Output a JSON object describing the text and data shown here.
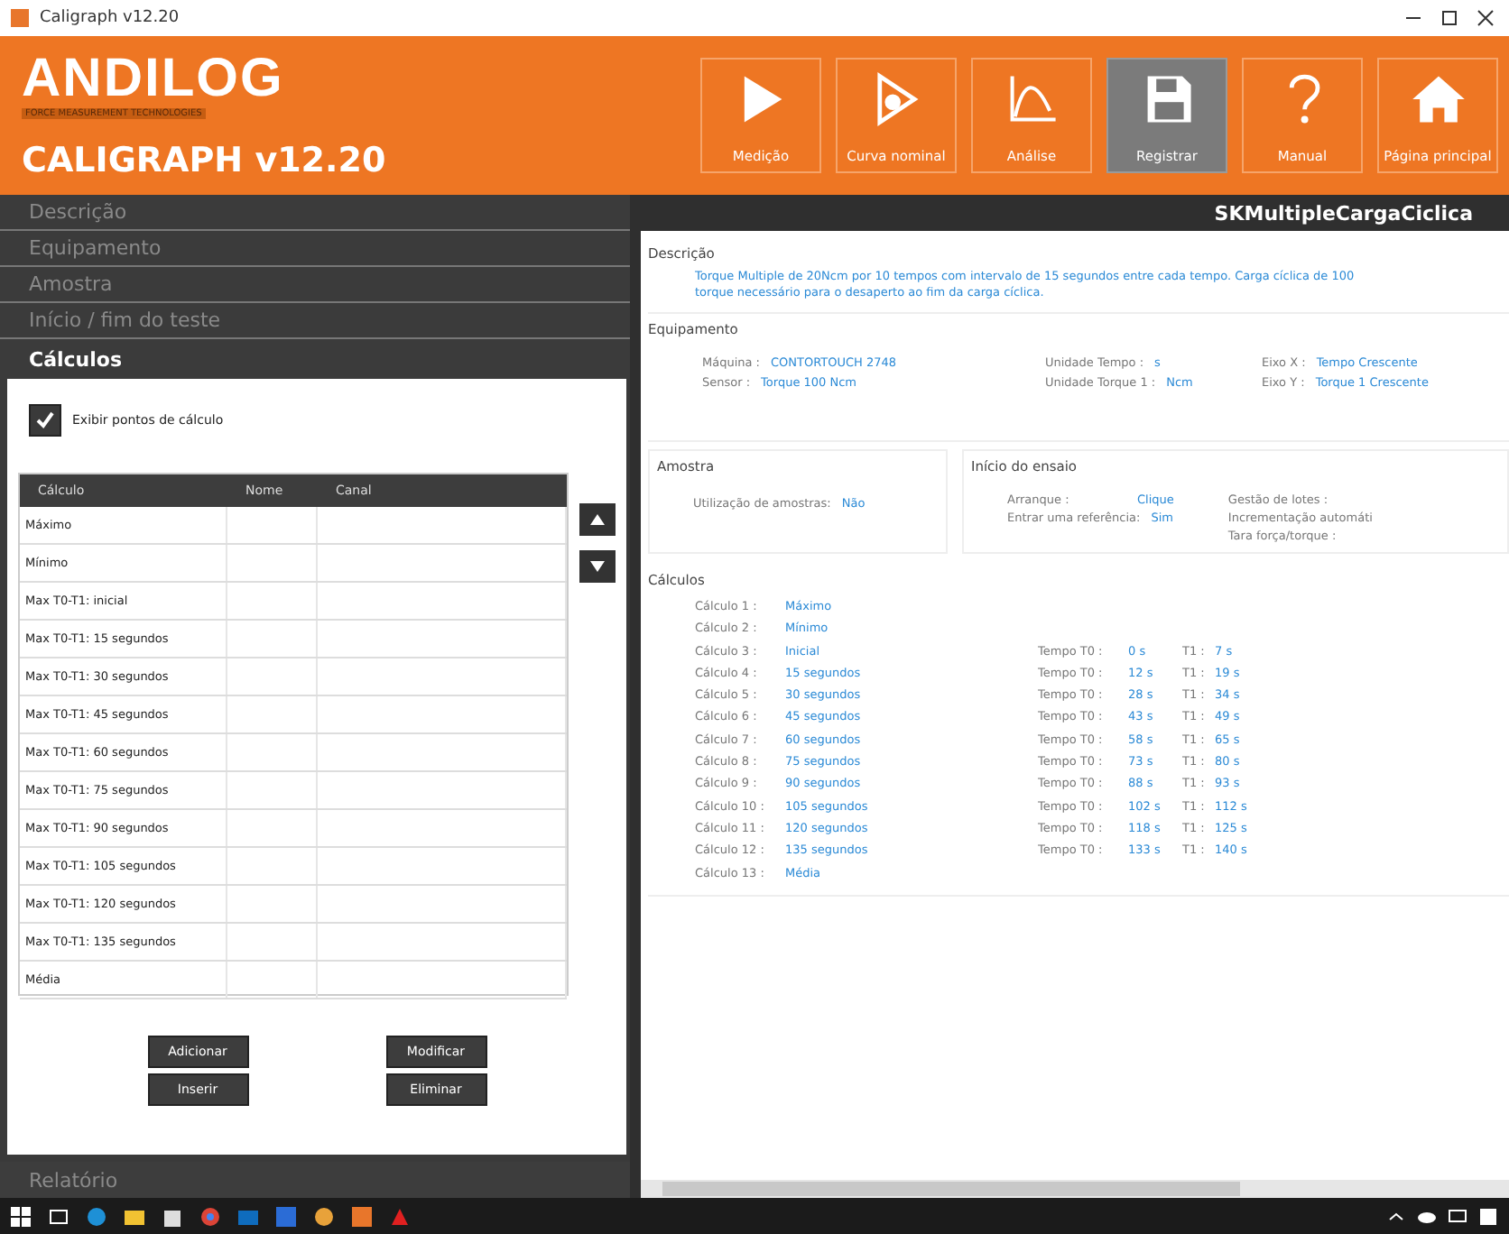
{
  "window": {
    "title": "Caligraph v12.20"
  },
  "brand": {
    "logo": "ANDILOG",
    "tagline": "FORCE MEASUREMENT TECHNOLOGIES",
    "product": "CALIGRAPH v12.20"
  },
  "toolbar": [
    {
      "label": "Medição",
      "kind": "play",
      "selected": false
    },
    {
      "label": "Curva nominal",
      "kind": "curve",
      "selected": false
    },
    {
      "label": "Análise",
      "kind": "chart",
      "selected": false
    },
    {
      "label": "Registrar",
      "kind": "save",
      "selected": true
    },
    {
      "label": "Manual",
      "kind": "help",
      "selected": false
    },
    {
      "label": "Página principal",
      "kind": "home",
      "selected": false
    }
  ],
  "sidebar": {
    "sections": [
      {
        "label": "Descrição",
        "expanded": false
      },
      {
        "label": "Equipamento",
        "expanded": false
      },
      {
        "label": "Amostra",
        "expanded": false
      },
      {
        "label": "Início / fim do teste",
        "expanded": false
      },
      {
        "label": "Cálculos",
        "expanded": true
      }
    ],
    "show_points": {
      "label": "Exibir pontos de cálculo",
      "checked": true
    },
    "table": {
      "columns": [
        "Cálculo",
        "Nome",
        "Canal"
      ],
      "rows": [
        "Máximo",
        "Mínimo",
        "Max T0-T1: inicial",
        "Max T0-T1: 15 segundos",
        "Max T0-T1: 30 segundos",
        "Max T0-T1: 45 segundos",
        "Max T0-T1: 60 segundos",
        "Max T0-T1: 75 segundos",
        "Max T0-T1: 90 segundos",
        "Max T0-T1: 105 segundos",
        "Max T0-T1: 120 segundos",
        "Max T0-T1: 135 segundos",
        "Média"
      ]
    },
    "buttons": [
      "Adicionar",
      "Modificar",
      "Inserir",
      "Eliminar"
    ],
    "footer": "Relatório"
  },
  "report": {
    "title": "SKMultipleCargaCiclica",
    "description": {
      "heading": "Descrição",
      "text": "Torque Multiple de 20Ncm por 10 tempos com intervalo de 15 segundos entre cada tempo. Carga cíclica de 100",
      "text2": "torque necessário para o desaperto ao fim da carga cíclica."
    },
    "equipment": {
      "heading": "Equipamento",
      "fields": [
        {
          "label": "Máquina :",
          "value": "CONTORTOUCH 2748"
        },
        {
          "label": "Unidade Tempo :",
          "value": "s"
        },
        {
          "label": "Eixo X :",
          "value": "Tempo   Crescente"
        },
        {
          "label": "Sensor :",
          "value": "Torque 100 Ncm"
        },
        {
          "label": "Unidade Torque 1 :",
          "value": "Ncm"
        },
        {
          "label": "Eixo Y :",
          "value": "Torque 1 Crescente"
        }
      ]
    },
    "sample": {
      "heading": "Amostra",
      "label": "Utilização de amostras:",
      "value": "Não"
    },
    "start": {
      "heading": "Início do ensaio",
      "fields": [
        {
          "label": "Arranque :",
          "value": "Clique"
        },
        {
          "label": "Entrar uma referência:",
          "value": "Sim"
        }
      ],
      "extra": [
        "Gestão de lotes :",
        "Incrementação automáti",
        "Tara força/torque :"
      ]
    },
    "calcs": {
      "heading": "Cálculos",
      "rows": [
        {
          "label": "Cálculo 1 :",
          "value": "Máximo"
        },
        {
          "label": "Cálculo 2 :",
          "value": "Mínimo"
        },
        {
          "label": "Cálculo 3 :",
          "value": "Inicial",
          "t0_label": "Tempo T0 :",
          "t0": "0 s",
          "t1_label": "T1 :",
          "t1": "7 s"
        },
        {
          "label": "Cálculo 4 :",
          "value": "15 segundos",
          "t0_label": "Tempo T0 :",
          "t0": "12 s",
          "t1_label": "T1 :",
          "t1": "19 s"
        },
        {
          "label": "Cálculo 5 :",
          "value": "30 segundos",
          "t0_label": "Tempo T0 :",
          "t0": "28 s",
          "t1_label": "T1 :",
          "t1": "34 s"
        },
        {
          "label": "Cálculo 6 :",
          "value": "45 segundos",
          "t0_label": "Tempo T0 :",
          "t0": "43 s",
          "t1_label": "T1 :",
          "t1": "49 s"
        },
        {
          "label": "Cálculo 7 :",
          "value": "60 segundos",
          "t0_label": "Tempo T0 :",
          "t0": "58 s",
          "t1_label": "T1 :",
          "t1": "65 s"
        },
        {
          "label": "Cálculo 8 :",
          "value": "75 segundos",
          "t0_label": "Tempo T0 :",
          "t0": "73 s",
          "t1_label": "T1 :",
          "t1": "80 s"
        },
        {
          "label": "Cálculo 9 :",
          "value": "90 segundos",
          "t0_label": "Tempo T0 :",
          "t0": "88 s",
          "t1_label": "T1 :",
          "t1": "93 s"
        },
        {
          "label": "Cálculo 10 :",
          "value": "105 segundos",
          "t0_label": "Tempo T0 :",
          "t0": "102 s",
          "t1_label": "T1 :",
          "t1": "112 s"
        },
        {
          "label": "Cálculo 11 :",
          "value": "120 segundos",
          "t0_label": "Tempo T0 :",
          "t0": "118 s",
          "t1_label": "T1 :",
          "t1": "125 s"
        },
        {
          "label": "Cálculo 12 :",
          "value": "135 segundos",
          "t0_label": "Tempo T0 :",
          "t0": "133 s",
          "t1_label": "T1 :",
          "t1": "140 s"
        },
        {
          "label": "Cálculo 13 :",
          "value": "Média"
        }
      ]
    }
  }
}
